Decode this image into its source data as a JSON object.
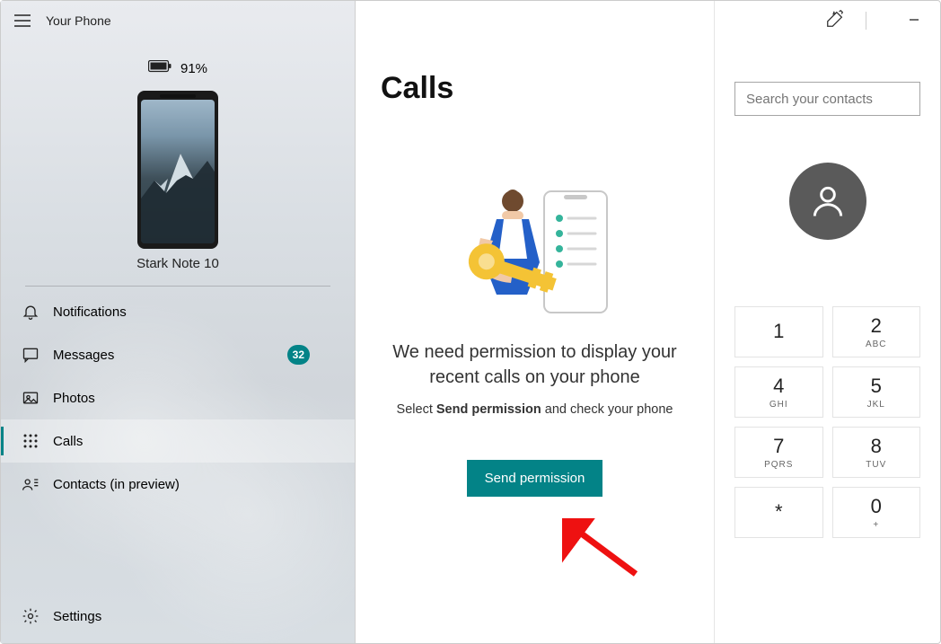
{
  "app": {
    "title": "Your Phone"
  },
  "phone": {
    "battery": "91%",
    "name": "Stark Note 10"
  },
  "nav": [
    {
      "label": "Notifications",
      "icon": "bell-icon"
    },
    {
      "label": "Messages",
      "icon": "chat-icon",
      "badge": "32"
    },
    {
      "label": "Photos",
      "icon": "photo-icon"
    },
    {
      "label": "Calls",
      "icon": "dialpad-icon",
      "active": true
    },
    {
      "label": "Contacts (in preview)",
      "icon": "contacts-icon"
    }
  ],
  "settings": {
    "label": "Settings"
  },
  "calls": {
    "heading": "Calls",
    "title_line1": "We need permission to display your",
    "title_line2": "recent calls on your phone",
    "sub_prefix": "Select ",
    "sub_strong": "Send permission",
    "sub_suffix": " and check your phone",
    "button": "Send permission"
  },
  "search": {
    "placeholder": "Search your contacts"
  },
  "dialpad": [
    {
      "digit": "1",
      "letters": ""
    },
    {
      "digit": "2",
      "letters": "ABC"
    },
    {
      "digit": "4",
      "letters": "GHI"
    },
    {
      "digit": "5",
      "letters": "JKL"
    },
    {
      "digit": "7",
      "letters": "PQRS"
    },
    {
      "digit": "8",
      "letters": "TUV"
    },
    {
      "digit": "*",
      "letters": ""
    },
    {
      "digit": "0",
      "letters": "+"
    }
  ]
}
